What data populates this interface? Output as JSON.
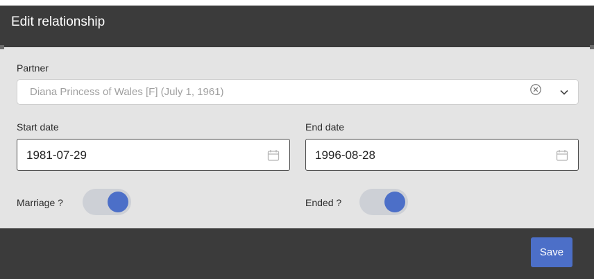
{
  "dialog": {
    "title": "Edit relationship"
  },
  "partner": {
    "label": "Partner",
    "value": "Diana Princess of Wales [F] (July 1, 1961)"
  },
  "start_date": {
    "label": "Start date",
    "value": "1981-07-29"
  },
  "end_date": {
    "label": "End date",
    "value": "1996-08-28"
  },
  "marriage_toggle": {
    "label": "Marriage ?",
    "checked": true
  },
  "ended_toggle": {
    "label": "Ended ?",
    "checked": true
  },
  "footer": {
    "save_label": "Save"
  },
  "colors": {
    "accent": "#4c6fc8",
    "header_bg": "#3b3b3b",
    "body_bg": "#e4e4e4"
  },
  "icons": {
    "clear": "clear-circle-icon",
    "dropdown": "chevron-down-icon",
    "calendar": "calendar-icon"
  }
}
